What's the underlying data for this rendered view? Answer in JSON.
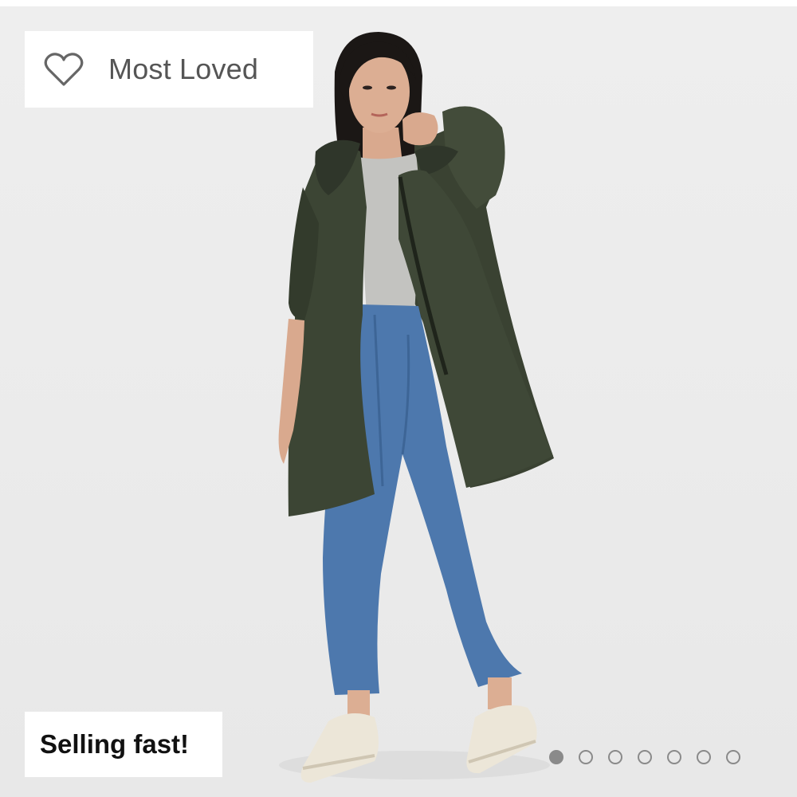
{
  "badges": {
    "loved": {
      "label": "Most Loved",
      "icon": "heart-outline-icon"
    },
    "fast": {
      "label": "Selling fast!"
    }
  },
  "carousel": {
    "total_slides": 7,
    "active_index": 0
  },
  "photo": {
    "subject": "model wearing dark olive hooded parka, grey top, blue straight-leg jeans and cream sneakers"
  },
  "colors": {
    "background": "#ebebeb",
    "coat": "#3c4534",
    "jeans": "#4d78ad",
    "dot": "#8a8a8a"
  }
}
